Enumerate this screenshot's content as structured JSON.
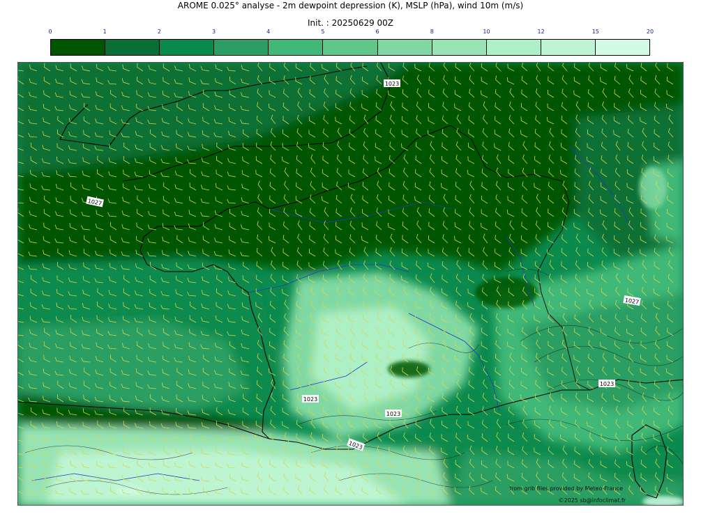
{
  "title": "AROME 0.025° analyse - 2m dewpoint depression (K), MSLP (hPa), wind 10m (m/s)",
  "subtitle": "Init. : 20250629 00Z",
  "colorbar": {
    "ticks": [
      "0",
      "1",
      "2",
      "3",
      "4",
      "5",
      "6",
      "8",
      "10",
      "12",
      "15",
      "20"
    ],
    "colors": [
      "#005600",
      "#0a6f35",
      "#0b8a4e",
      "#2b9e63",
      "#41b878",
      "#5fc789",
      "#80d8a2",
      "#98e3b3",
      "#aef0c5",
      "#bdf5d2",
      "#d3fbe3"
    ]
  },
  "map": {
    "isobar_labels": [
      "1023",
      "1027",
      "1027",
      "1023",
      "1023",
      "1023",
      "1023"
    ],
    "barb_color": "#d8d84a",
    "coast_color": "#000000",
    "river_color": "#1e3cc8"
  },
  "credits": {
    "line1": "from grib files provided by Meteo-France",
    "line2": "©2025 sb@infoclimat.fr"
  }
}
